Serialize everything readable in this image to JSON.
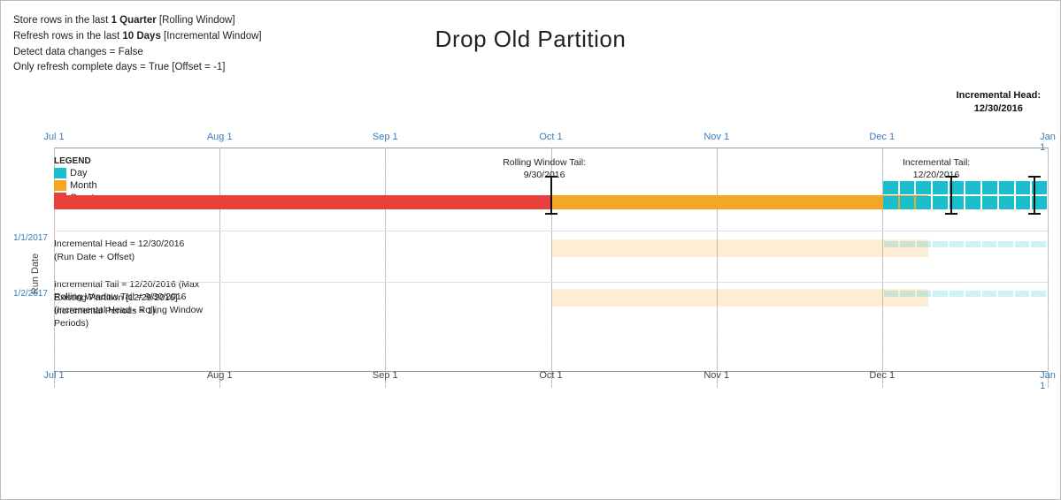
{
  "title": "Drop Old Partition",
  "info": {
    "line1_prefix": "Store rows in the last ",
    "line1_bold": "1 Quarter",
    "line1_suffix": " [Rolling Window]",
    "line2_prefix": "Refresh rows in the last ",
    "line2_bold": "10 Days",
    "line2_suffix": " [Incremental Window]",
    "line3": "Detect data changes = False",
    "line4": "Only refresh complete days = True [Offset = -1]"
  },
  "incremental_head_label": "Incremental Head:\n12/30/2016",
  "legend": {
    "title": "LEGEND",
    "items": [
      {
        "label": "Day",
        "color": "#1bbecc"
      },
      {
        "label": "Month",
        "color": "#f5a623"
      },
      {
        "label": "Quarter",
        "color": "#e8403a"
      }
    ]
  },
  "x_labels": [
    "Jul 1",
    "Aug 1",
    "Sep 1",
    "Oct 1",
    "Nov 1",
    "Dec 1",
    "Jan 1"
  ],
  "annotations": {
    "inc_head": "Incremental Head = 12/30/2016\n(Run Date + Offset)",
    "inc_tail": "Incremental Tail = 12/20/2016 (Max\nExisting Partition [12/29/2016] -\nIncremental Periods + 1).",
    "rolling_tail": "Rolling Window Tail = 9/30/2016\n(Incremental Head - Rolling Window\nPeriods)",
    "rolling_window_tail_above": "Rolling Window Tail:\n9/30/2016",
    "incremental_tail_right": "Incremental Tail:\n12/20/2016"
  },
  "run_date_labels": {
    "title": "Run Date",
    "row1": "1/1/2017",
    "row2": "1/2/2017"
  },
  "colors": {
    "day": "#1bbecc",
    "month": "#f5a623",
    "quarter": "#e8403a",
    "day_light": "rgba(27,190,204,0.22)",
    "month_light": "rgba(245,166,35,0.22)",
    "quarter_light": "rgba(232,64,58,0.22)",
    "axis_label": "#3a7abf"
  }
}
